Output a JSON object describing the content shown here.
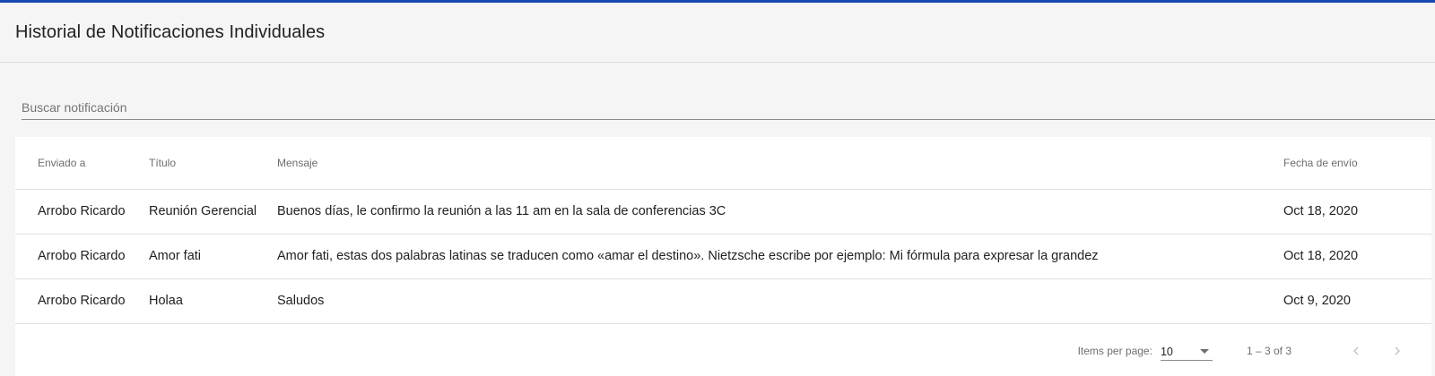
{
  "header": {
    "title": "Historial de Notificaciones Individuales"
  },
  "search": {
    "placeholder": "Buscar notificación",
    "value": ""
  },
  "table": {
    "columns": [
      "Enviado a",
      "Título",
      "Mensaje",
      "Fecha de envío"
    ],
    "rows": [
      [
        "Arrobo Ricardo",
        "Reunión Gerencial",
        "Buenos días, le confirmo la reunión a las 11 am en la sala de conferencias 3C",
        "Oct 18, 2020"
      ],
      [
        "Arrobo Ricardo",
        "Amor fati",
        "Amor fati, estas dos palabras latinas se traducen como «amar el destino». Nietzsche escribe por ejemplo: Mi fórmula para expresar la grandez",
        "Oct 18, 2020"
      ],
      [
        "Arrobo Ricardo",
        "Holaa",
        "Saludos",
        "Oct 9, 2020"
      ]
    ]
  },
  "paginator": {
    "items_per_page_label": "Items per page:",
    "items_per_page_value": "10",
    "range_label": "1 – 3 of 3"
  },
  "icons": {
    "dropdown": "chevron-down-icon",
    "prev": "chevron-left-icon",
    "next": "chevron-right-icon"
  },
  "colors": {
    "accent": "#1847b4",
    "background": "#f5f5f5",
    "card": "#ffffff"
  }
}
